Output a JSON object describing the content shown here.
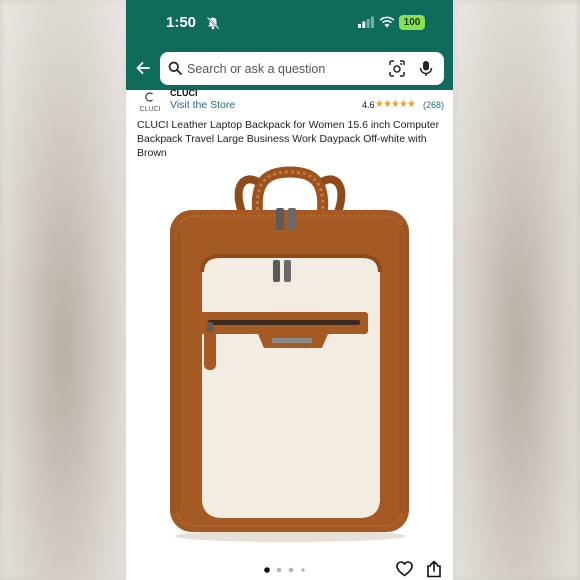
{
  "status": {
    "time": "1:50",
    "battery": "100"
  },
  "search": {
    "placeholder": "Search or ask a question"
  },
  "store": {
    "logo_text": "CLUCI",
    "brand_name": "CLUCI",
    "visit_label": "Visit the Store",
    "rating": "4.6",
    "stars": "★★★★★",
    "rating_count": "(268)"
  },
  "product": {
    "title": "CLUCI Leather Laptop Backpack for Women 15.6 inch Computer Backpack Travel Large Business Work Daypack Off-white with Brown"
  },
  "gallery": {
    "total_images": 4,
    "current_index": 1
  },
  "icons": {
    "back": "back-arrow-icon",
    "search": "search-icon",
    "lens": "camera-lens-icon",
    "mic": "microphone-icon",
    "heart": "heart-icon",
    "share": "share-icon"
  },
  "colors": {
    "header": "#0f6b5c",
    "battery": "#8be04e",
    "link": "#1a6d8f",
    "stars": "#e8a12b",
    "leather": "#a55a24",
    "canvas": "#f2ece3"
  }
}
